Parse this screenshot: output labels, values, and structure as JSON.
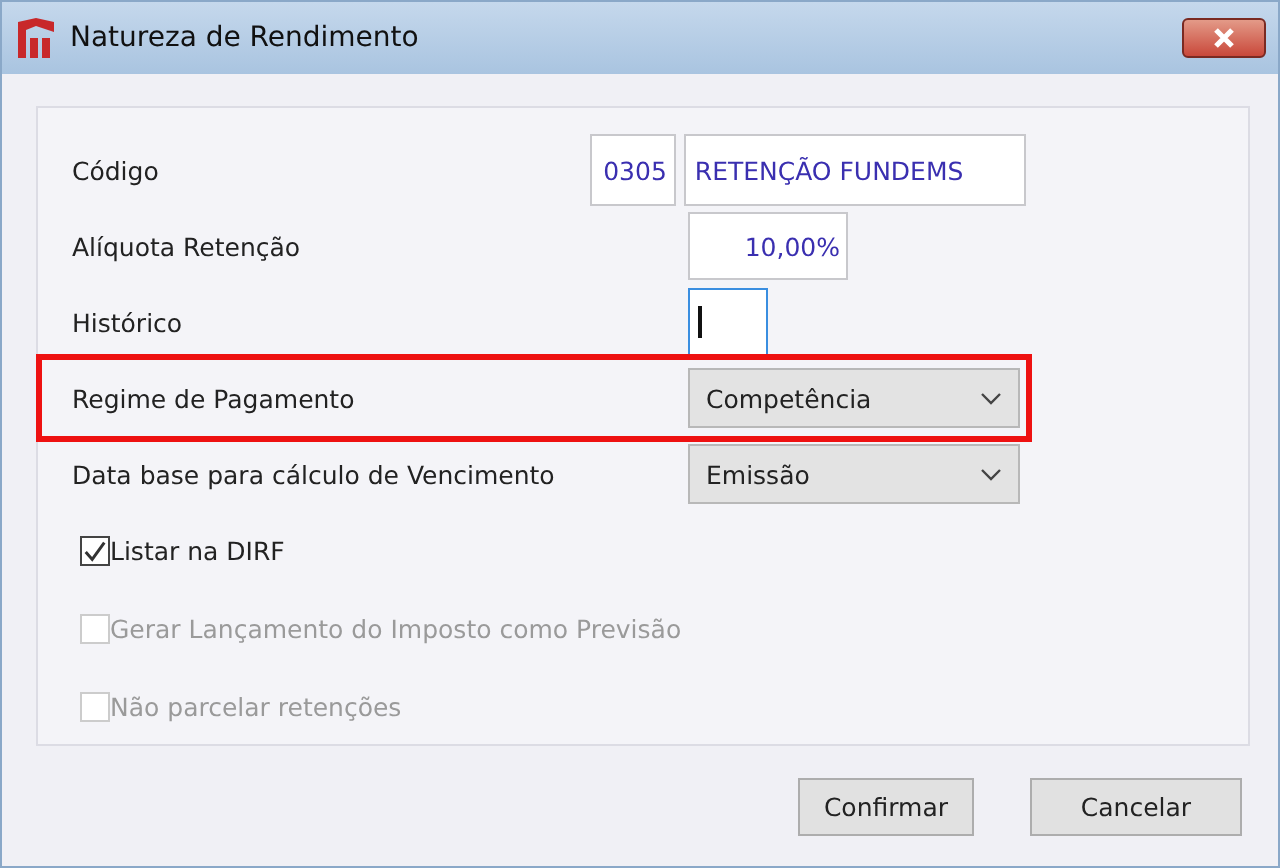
{
  "window": {
    "title": "Natureza de Rendimento"
  },
  "fields": [
    {
      "kind": "code",
      "label": "Código",
      "code": "0305",
      "value": "RETENÇÃO FUNDEMS",
      "highlighted": false
    },
    {
      "kind": "text",
      "label": "Alíquota Retenção",
      "value": "10,00%",
      "highlighted": false
    },
    {
      "kind": "caret",
      "label": "Histórico",
      "focused": true,
      "highlighted": false
    },
    {
      "kind": "combo",
      "label": "Regime de Pagamento",
      "value": "Competência",
      "highlighted": true
    },
    {
      "kind": "combo",
      "label": "Data base para cálculo de Vencimento",
      "value": "Emissão",
      "highlighted": false
    }
  ],
  "checkboxes": [
    {
      "label": "Listar na DIRF",
      "checked": true,
      "disabled": false
    },
    {
      "label": "Gerar Lançamento do Imposto como Previsão",
      "checked": false,
      "disabled": true
    },
    {
      "label": "Não parcelar retenções",
      "checked": false,
      "disabled": true
    }
  ],
  "buttons": [
    "Confirmar",
    "Cancelar"
  ]
}
